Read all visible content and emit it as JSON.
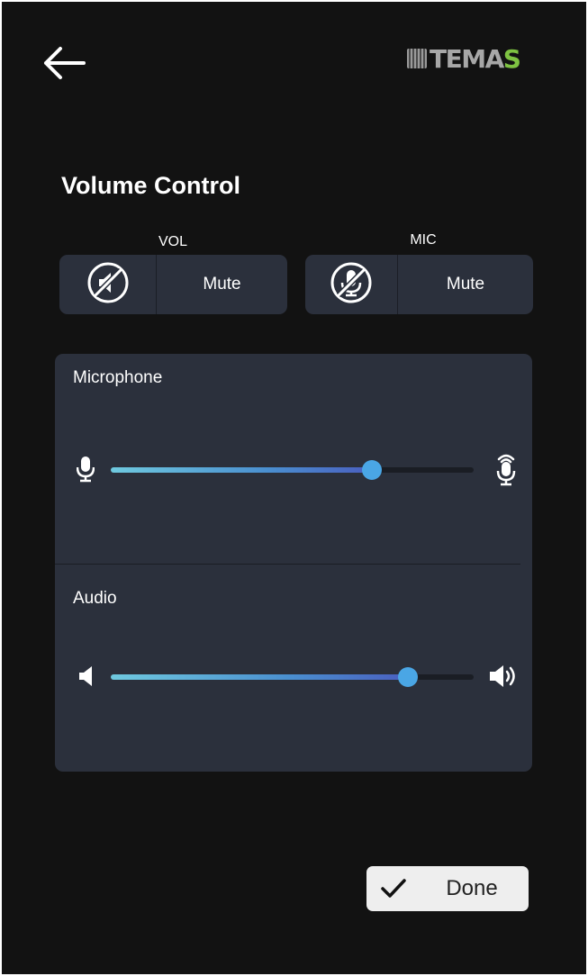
{
  "logo": {
    "text_main": "TEMA",
    "text_accent": "S",
    "accent_color": "#7ec242"
  },
  "page": {
    "title": "Volume Control"
  },
  "vol_group": {
    "label": "VOL",
    "button_label": "Mute",
    "icon": "speaker-muted-icon"
  },
  "mic_group": {
    "label": "MIC",
    "button_label": "Mute",
    "icon": "mic-muted-icon"
  },
  "microphone": {
    "label": "Microphone",
    "level": 0.72,
    "icon_low": "mic-icon",
    "icon_high": "mic-loud-icon"
  },
  "audio": {
    "label": "Audio",
    "level": 0.82,
    "icon_low": "speaker-low-icon",
    "icon_high": "speaker-high-icon"
  },
  "footer": {
    "done_label": "Done",
    "done_icon": "check-icon"
  },
  "colors": {
    "background": "#121212",
    "panel": "#2b303c",
    "thumb": "#4aa6e5",
    "done_button": "#eeeeee"
  }
}
